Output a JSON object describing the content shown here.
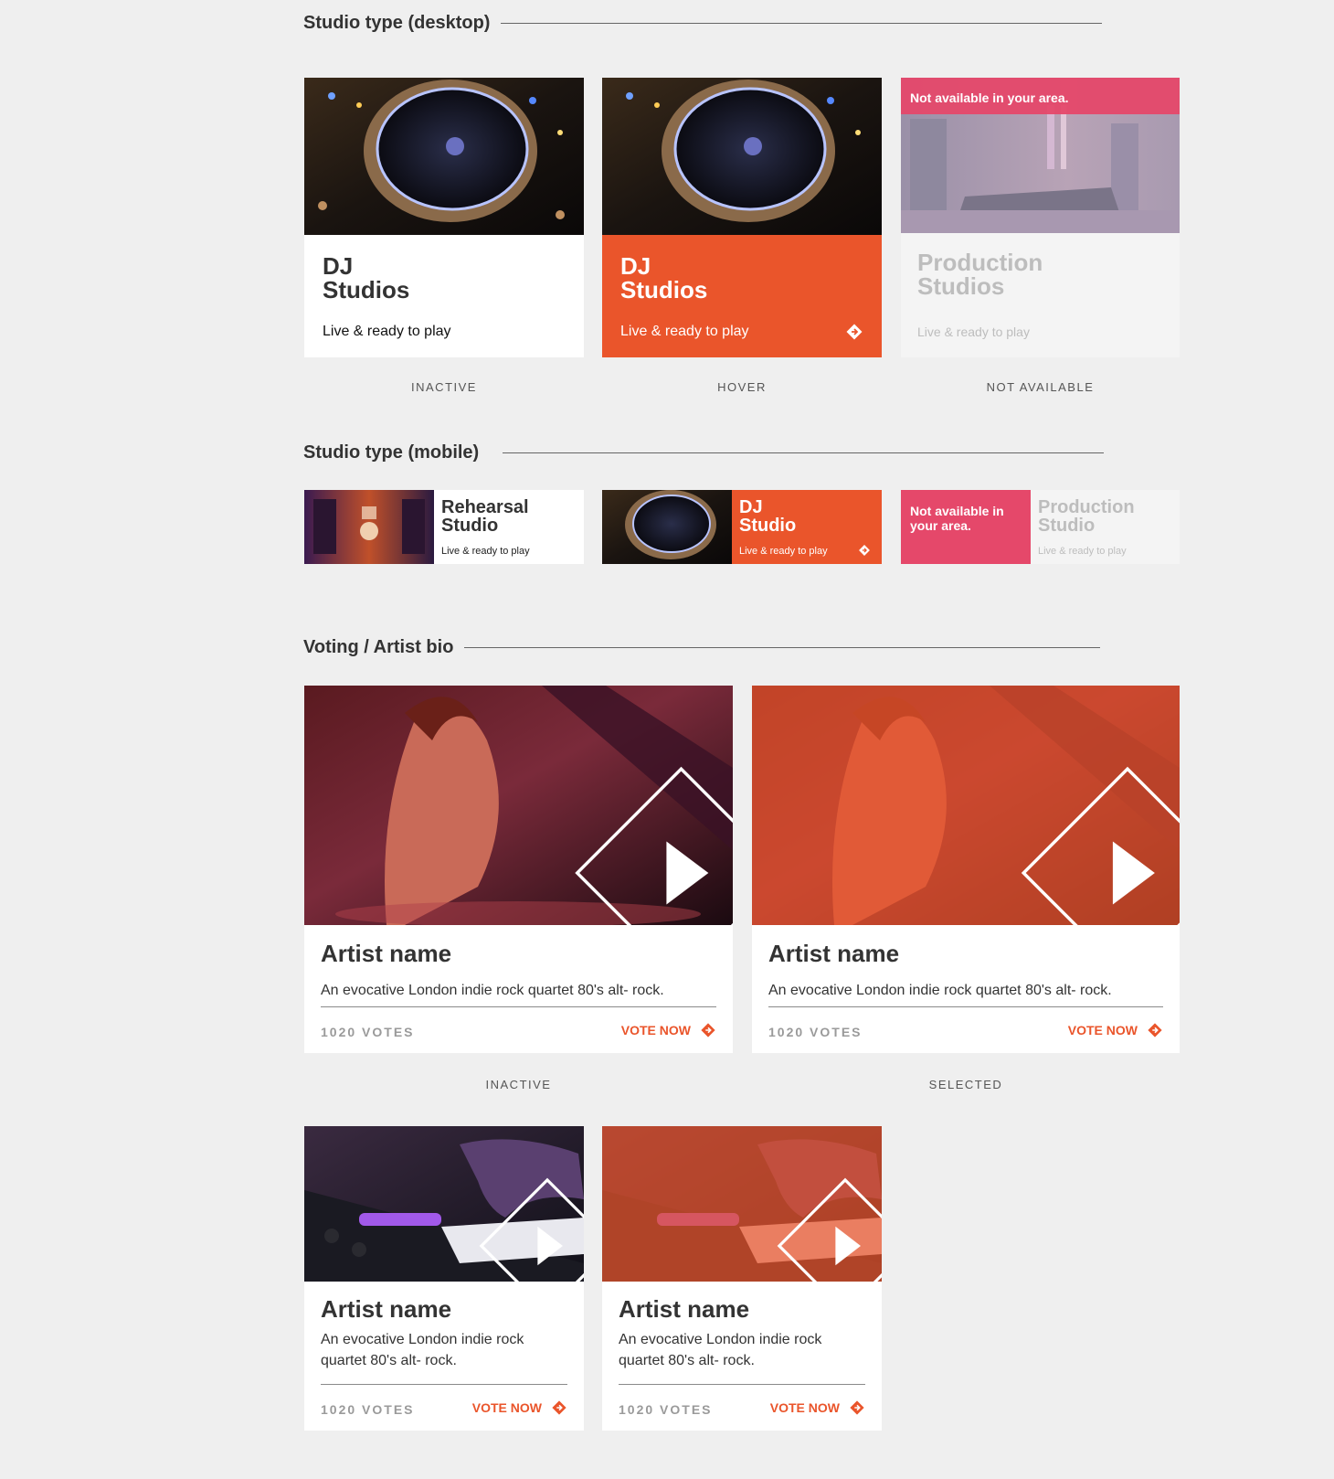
{
  "sections": {
    "desktop_title": "Studio type (desktop)",
    "mobile_title": "Studio type (mobile)",
    "voting_title": "Voting / Artist bio"
  },
  "desktop_cards": {
    "inactive": {
      "title_line1": "DJ",
      "title_line2": "Studios",
      "subtitle": "Live & ready to play",
      "state": "INACTIVE"
    },
    "hover": {
      "title_line1": "DJ",
      "title_line2": "Studios",
      "subtitle": "Live & ready to play",
      "state": "HOVER"
    },
    "not_available": {
      "banner": "Not available in your area.",
      "title_line1": "Production",
      "title_line2": "Studios",
      "subtitle": "Live & ready to play",
      "state": "NOT AVAILABLE"
    }
  },
  "mobile_cards": {
    "inactive": {
      "title_line1": "Rehearsal",
      "title_line2": "Studio",
      "subtitle": "Live & ready to play"
    },
    "hover": {
      "title_line1": "DJ",
      "title_line2": "Studio",
      "subtitle": "Live & ready to play"
    },
    "not_available": {
      "banner_line1": "Not available in",
      "banner_line2": "your area.",
      "title_line1": "Production",
      "title_line2": "Studio",
      "subtitle": "Live & ready to play"
    }
  },
  "artist_cards": {
    "large_inactive": {
      "name": "Artist name",
      "desc": "An evocative London indie rock quartet 80's alt- rock.",
      "votes": "1020 VOTES",
      "vote_label": "VOTE NOW",
      "state": "INACTIVE"
    },
    "large_selected": {
      "name": "Artist name",
      "desc": "An evocative London indie rock quartet 80's alt- rock.",
      "votes": "1020 VOTES",
      "vote_label": "VOTE NOW",
      "state": "SELECTED"
    },
    "small_inactive": {
      "name": "Artist name",
      "desc_line1": "An evocative London indie rock",
      "desc_line2": "quartet 80's alt- rock.",
      "votes": "1020 VOTES",
      "vote_label": "VOTE NOW"
    },
    "small_selected": {
      "name": "Artist name",
      "desc_line1": "An evocative London indie rock",
      "desc_line2": "quartet 80's alt- rock.",
      "votes": "1020 VOTES",
      "vote_label": "VOTE NOW"
    }
  },
  "colors": {
    "accent": "#ea552b",
    "unavailable": "#e5486a",
    "background": "#efefef"
  }
}
